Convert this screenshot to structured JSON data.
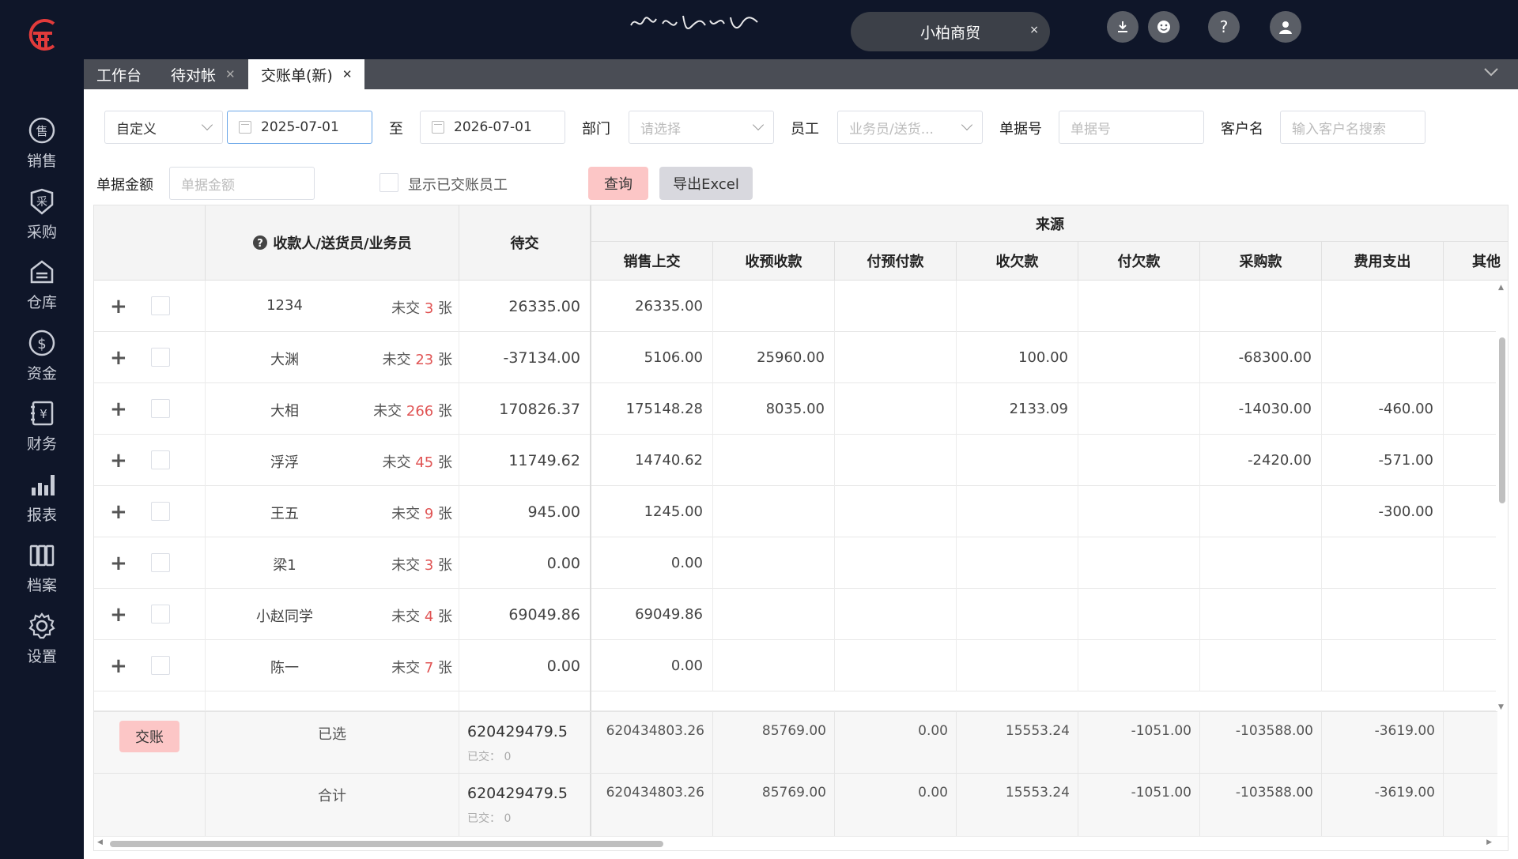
{
  "sidebar": {
    "items": [
      {
        "label": "销售",
        "icon": "sale-icon"
      },
      {
        "label": "采购",
        "icon": "purchase-icon"
      },
      {
        "label": "仓库",
        "icon": "warehouse-icon"
      },
      {
        "label": "资金",
        "icon": "fund-icon"
      },
      {
        "label": "财务",
        "icon": "finance-icon"
      },
      {
        "label": "报表",
        "icon": "report-icon"
      },
      {
        "label": "档案",
        "icon": "archive-icon"
      },
      {
        "label": "设置",
        "icon": "settings-icon"
      }
    ]
  },
  "topbar": {
    "company": "小柏商贸",
    "close_glyph": "×",
    "help_glyph": "?"
  },
  "tabs": [
    {
      "label": "工作台",
      "closable": false
    },
    {
      "label": "待对帐",
      "closable": true
    },
    {
      "label": "交账单(新)",
      "closable": true,
      "active": true
    }
  ],
  "filters": {
    "range_type": "自定义",
    "date_from": "2025-07-01",
    "to_label": "至",
    "date_to": "2026-07-01",
    "dept_label": "部门",
    "dept_placeholder": "请选择",
    "staff_label": "员工",
    "staff_placeholder": "业务员/送货...",
    "bill_no_label": "单据号",
    "bill_no_placeholder": "单据号",
    "customer_label": "客户名",
    "customer_placeholder": "输入客户名搜索",
    "amount_label": "单据金额",
    "amount_placeholder": "单据金额",
    "show_settled_label": "显示已交账员工",
    "query_button": "查询",
    "export_button": "导出Excel"
  },
  "table": {
    "headers": {
      "payee": "收款人/送货员/业务员",
      "pending": "待交",
      "source": "来源",
      "cols": [
        "销售上交",
        "收预收款",
        "付预付款",
        "收欠款",
        "付欠款",
        "采购款",
        "费用支出",
        "其他"
      ]
    },
    "unpaid_prefix": "未交",
    "unpaid_suffix": "张",
    "rows": [
      {
        "name": "1234",
        "unpaid": "3",
        "pending": "26335.00",
        "cols": [
          "26335.00",
          "",
          "",
          "",
          "",
          "",
          ""
        ]
      },
      {
        "name": "大渊",
        "unpaid": "23",
        "pending": "-37134.00",
        "cols": [
          "5106.00",
          "25960.00",
          "",
          "100.00",
          "",
          "-68300.00",
          ""
        ]
      },
      {
        "name": "大相",
        "unpaid": "266",
        "pending": "170826.37",
        "cols": [
          "175148.28",
          "8035.00",
          "",
          "2133.09",
          "",
          "-14030.00",
          "-460.00"
        ]
      },
      {
        "name": "浮浮",
        "unpaid": "45",
        "pending": "11749.62",
        "cols": [
          "14740.62",
          "",
          "",
          "",
          "",
          "-2420.00",
          "-571.00"
        ]
      },
      {
        "name": "王五",
        "unpaid": "9",
        "pending": "945.00",
        "cols": [
          "1245.00",
          "",
          "",
          "",
          "",
          "",
          "-300.00"
        ]
      },
      {
        "name": "梁1",
        "unpaid": "3",
        "pending": "0.00",
        "cols": [
          "0.00",
          "",
          "",
          "",
          "",
          "",
          ""
        ]
      },
      {
        "name": "小赵同学",
        "unpaid": "4",
        "pending": "69049.86",
        "cols": [
          "69049.86",
          "",
          "",
          "",
          "",
          "",
          ""
        ]
      },
      {
        "name": "陈一",
        "unpaid": "7",
        "pending": "0.00",
        "cols": [
          "0.00",
          "",
          "",
          "",
          "",
          "",
          ""
        ]
      }
    ],
    "selected": {
      "label": "已选",
      "button": "交账",
      "pending": "620429479.5",
      "paid": "已交： 0",
      "cols": [
        "620434803.26",
        "85769.00",
        "0.00",
        "15553.24",
        "-1051.00",
        "-103588.00",
        "-3619.00"
      ]
    },
    "total": {
      "label": "合计",
      "pending": "620429479.5",
      "paid": "已交： 0",
      "cols": [
        "620434803.26",
        "85769.00",
        "0.00",
        "15553.24",
        "-1051.00",
        "-103588.00",
        "-3619.00"
      ]
    }
  }
}
